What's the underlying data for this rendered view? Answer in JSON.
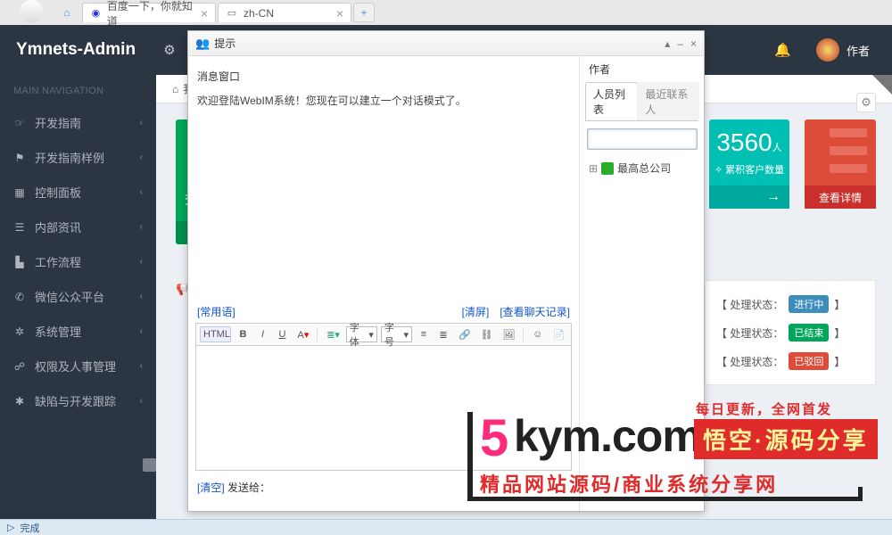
{
  "browser": {
    "tab1": "百度一下，你就知道",
    "tab2": "zh-CN"
  },
  "header": {
    "brand": "Ymnets-Admin",
    "user": "作者"
  },
  "sidebar": {
    "section": "MAIN NAVIGATION",
    "items": [
      {
        "icon": "hand",
        "label": "开发指南"
      },
      {
        "icon": "flag",
        "label": "开发指南样例"
      },
      {
        "icon": "th",
        "label": "控制面板"
      },
      {
        "icon": "list",
        "label": "内部资讯"
      },
      {
        "icon": "bars",
        "label": "工作流程"
      },
      {
        "icon": "wechat",
        "label": "微信公众平台"
      },
      {
        "icon": "cog",
        "label": "系统管理"
      },
      {
        "icon": "users",
        "label": "权限及人事管理"
      },
      {
        "icon": "bug",
        "label": "缺陷与开发跟踪"
      }
    ]
  },
  "tabbar": {
    "tab1": "我的"
  },
  "teal_card": {
    "number": "3560",
    "unit": "人",
    "sub": "✧ 累积客户数量"
  },
  "red_card": {
    "footer": "查看详情"
  },
  "status": {
    "label": "【 处理状态：",
    "end": "】",
    "s1": "进行中",
    "s2": "已结束",
    "s3": "已驳回"
  },
  "modal": {
    "title": "提示",
    "msg_title": "消息窗口",
    "msg_text": "欢迎登陆WebIM系统！您现在可以建立一个对话模式了。",
    "common": "[常用语]",
    "clear": "[清屏]",
    "history": "[查看聊天记录]",
    "clear2": "[清空]",
    "sendto": "发送给：",
    "right_header": "作者",
    "tab_people": "人员列表",
    "tab_recent": "最近联系人",
    "tree_root": "最高总公司",
    "toolbar": {
      "html": "HTML",
      "font": "字体",
      "size": "字号"
    }
  },
  "statusbar": {
    "text": "完成"
  },
  "watermark": {
    "domain": "kym.com",
    "five": "5",
    "tagtop": "每日更新，全网首发",
    "cn": "悟空·源码分享",
    "sub": "精品网站源码/商业系统分享网"
  }
}
